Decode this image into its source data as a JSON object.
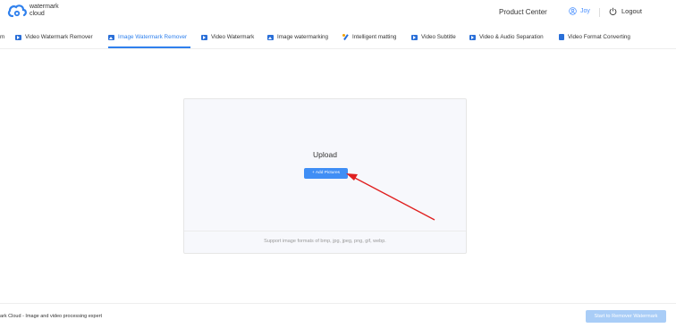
{
  "header": {
    "logo_line1": "watermark",
    "logo_line2": "cloud",
    "product_center": "Product Center",
    "user_name": "Joy",
    "logout_label": "Logout"
  },
  "nav": {
    "items": [
      {
        "label": "m",
        "icon": "none"
      },
      {
        "label": "Video Watermark Remover",
        "icon": "video-icon"
      },
      {
        "label": "Image Watermark Remover",
        "icon": "image-icon",
        "active": true
      },
      {
        "label": "Video Watermark",
        "icon": "video-icon"
      },
      {
        "label": "Image watermarking",
        "icon": "image-icon"
      },
      {
        "label": "Intelligent matting",
        "icon": "magic-wand-icon"
      },
      {
        "label": "Video Subtitle",
        "icon": "video-icon"
      },
      {
        "label": "Video & Audio Separation",
        "icon": "video-icon"
      },
      {
        "label": "Video Format Converting",
        "icon": "document-icon"
      }
    ]
  },
  "upload": {
    "title": "Upload",
    "add_button": "+ Add Pictures",
    "formats": "Support image formats of bmp, jpg, jpeg, png, gif, webp."
  },
  "footer": {
    "text": "ark Cloud - Image and video processing expert",
    "start_button": "Start to Remover Watermark"
  },
  "colors": {
    "accent": "#2f80ed",
    "button": "#3f8ef5",
    "disabled_button": "#a9cdf7",
    "arrow": "#e02020"
  }
}
